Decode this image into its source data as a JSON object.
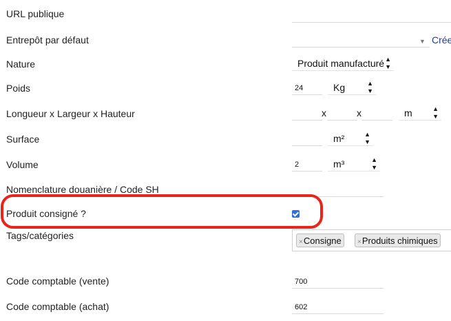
{
  "fields": {
    "url_publique": {
      "label": "URL publique",
      "value": ""
    },
    "entrepot": {
      "label": "Entrepôt par défaut",
      "value": "",
      "create_link": "Crée"
    },
    "nature": {
      "label": "Nature",
      "value": "Produit manufacturé"
    },
    "poids": {
      "label": "Poids",
      "value": "24",
      "unit": "Kg"
    },
    "dimensions": {
      "label": "Longueur x Largeur x Hauteur",
      "length": "",
      "width": "",
      "height": "",
      "sep": "x",
      "unit": "m"
    },
    "surface": {
      "label": "Surface",
      "value": "",
      "unit": "m²"
    },
    "volume": {
      "label": "Volume",
      "value": "2",
      "unit": "m³"
    },
    "nomenclature": {
      "label": "Nomenclature douanière / Code SH",
      "value": ""
    },
    "consigne": {
      "label": "Produit consigné ?",
      "checked": true
    },
    "tags": {
      "label": "Tags/catégories",
      "items": [
        "Consigne",
        "Produits chimiques"
      ],
      "remove_glyph": "×"
    },
    "compta_vente": {
      "label": "Code comptable (vente)",
      "value": "700"
    },
    "compta_achat": {
      "label": "Code comptable (achat)",
      "value": "602"
    }
  },
  "colors": {
    "highlight": "#e9251a",
    "checkbox": "#2f6fde",
    "link": "#263c90"
  },
  "icons": {
    "select_arrows": "updown-arrows-icon",
    "dropdown": "chevron-down-icon",
    "tag_remove": "close-icon"
  }
}
